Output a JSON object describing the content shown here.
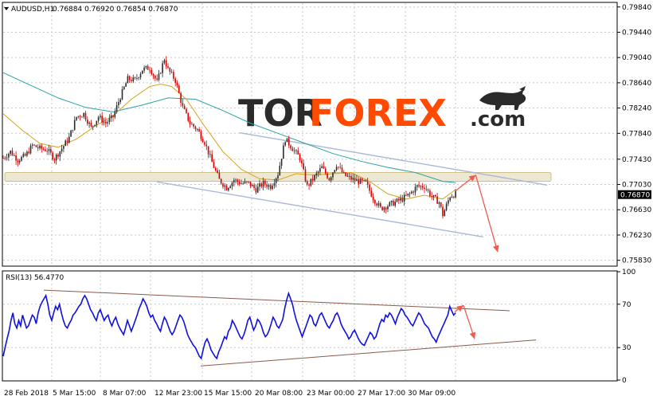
{
  "header": {
    "symbol": "AUDUSD,H1",
    "ohlc": "0.76884 0.76920 0.76854 0.76870",
    "rsi_label": "RSI(13) 56.4770"
  },
  "logo": {
    "part1": "TOR",
    "part2": "FOREX",
    "part3": ".com"
  },
  "colors": {
    "bull": "#2b2b2b",
    "bear": "#d40000",
    "ma_fast": "#d8a31a",
    "ma_slow": "#2aa3a3",
    "channel": "#aab8d8",
    "zone_fill": "#e9e4cc",
    "zone_stroke": "#cfc08a",
    "arrow": "#f05a50",
    "rsi_line": "#1010e0",
    "rsi_channel": "#8a5a4a",
    "logo_dark": "#2b2b2b",
    "logo_accent": "#ff4a00",
    "grid": "#c8c8c8"
  },
  "chart_data": [
    {
      "type": "candlestick",
      "title": "AUDUSD,H1",
      "y_ticks": [
        "0.79840",
        "0.79440",
        "0.79040",
        "0.78640",
        "0.78240",
        "0.77840",
        "0.77430",
        "0.77030",
        "0.76630",
        "0.76230",
        "0.75830"
      ],
      "ylim": [
        0.7575,
        0.799
      ],
      "current_price": "0.76870",
      "x_ticks": [
        "28 Feb 2018",
        "5 Mar 15:00",
        "8 Mar 07:00",
        "12 Mar 23:00",
        "15 Mar 15:00",
        "20 Mar 08:00",
        "23 Mar 00:00",
        "27 Mar 17:00",
        "30 Mar 09:00"
      ],
      "price_path": [
        [
          0,
          0.7745
        ],
        [
          4,
          0.7755
        ],
        [
          8,
          0.7742
        ],
        [
          12,
          0.7748
        ],
        [
          16,
          0.7765
        ],
        [
          20,
          0.776
        ],
        [
          24,
          0.7758
        ],
        [
          28,
          0.7744
        ],
        [
          32,
          0.776
        ],
        [
          36,
          0.7777
        ],
        [
          40,
          0.781
        ],
        [
          44,
          0.7815
        ],
        [
          48,
          0.7793
        ],
        [
          52,
          0.781
        ],
        [
          56,
          0.78
        ],
        [
          60,
          0.781
        ],
        [
          64,
          0.7842
        ],
        [
          68,
          0.787
        ],
        [
          72,
          0.7868
        ],
        [
          76,
          0.7885
        ],
        [
          80,
          0.7888
        ],
        [
          84,
          0.7865
        ],
        [
          88,
          0.7902
        ],
        [
          90,
          0.7885
        ],
        [
          94,
          0.7868
        ],
        [
          98,
          0.7825
        ],
        [
          102,
          0.78
        ],
        [
          106,
          0.779
        ],
        [
          110,
          0.777
        ],
        [
          114,
          0.7738
        ],
        [
          118,
          0.771
        ],
        [
          122,
          0.7698
        ],
        [
          126,
          0.771
        ],
        [
          130,
          0.7705
        ],
        [
          134,
          0.7705
        ],
        [
          138,
          0.7695
        ],
        [
          142,
          0.7705
        ],
        [
          146,
          0.77
        ],
        [
          150,
          0.772
        ],
        [
          154,
          0.7775
        ],
        [
          158,
          0.776
        ],
        [
          162,
          0.7745
        ],
        [
          166,
          0.77
        ],
        [
          170,
          0.7715
        ],
        [
          174,
          0.773
        ],
        [
          178,
          0.7712
        ],
        [
          182,
          0.7735
        ],
        [
          186,
          0.7718
        ],
        [
          190,
          0.7712
        ],
        [
          194,
          0.7708
        ],
        [
          198,
          0.7705
        ],
        [
          202,
          0.7682
        ],
        [
          206,
          0.7665
        ],
        [
          210,
          0.767
        ],
        [
          214,
          0.7675
        ],
        [
          218,
          0.768
        ],
        [
          222,
          0.7688
        ],
        [
          226,
          0.77
        ],
        [
          230,
          0.77
        ],
        [
          234,
          0.7684
        ],
        [
          238,
          0.7675
        ],
        [
          240,
          0.7655
        ],
        [
          244,
          0.7685
        ],
        [
          247,
          0.7688
        ]
      ],
      "ma_fast": [
        [
          0,
          0.7815
        ],
        [
          10,
          0.779
        ],
        [
          20,
          0.7768
        ],
        [
          30,
          0.7762
        ],
        [
          40,
          0.7775
        ],
        [
          50,
          0.7795
        ],
        [
          60,
          0.7812
        ],
        [
          70,
          0.7838
        ],
        [
          80,
          0.7858
        ],
        [
          86,
          0.7862
        ],
        [
          92,
          0.7858
        ],
        [
          100,
          0.7838
        ],
        [
          110,
          0.7795
        ],
        [
          120,
          0.7755
        ],
        [
          130,
          0.7727
        ],
        [
          140,
          0.7712
        ],
        [
          150,
          0.771
        ],
        [
          160,
          0.772
        ],
        [
          170,
          0.7718
        ],
        [
          180,
          0.772
        ],
        [
          190,
          0.7722
        ],
        [
          200,
          0.7708
        ],
        [
          210,
          0.7688
        ],
        [
          220,
          0.768
        ],
        [
          230,
          0.7686
        ],
        [
          240,
          0.768
        ],
        [
          247,
          0.7695
        ]
      ],
      "ma_slow": [
        [
          0,
          0.788
        ],
        [
          15,
          0.786
        ],
        [
          30,
          0.784
        ],
        [
          45,
          0.7825
        ],
        [
          60,
          0.7818
        ],
        [
          75,
          0.7828
        ],
        [
          90,
          0.784
        ],
        [
          105,
          0.7838
        ],
        [
          120,
          0.782
        ],
        [
          135,
          0.78
        ],
        [
          150,
          0.7784
        ],
        [
          165,
          0.7768
        ],
        [
          180,
          0.7752
        ],
        [
          195,
          0.774
        ],
        [
          210,
          0.773
        ],
        [
          225,
          0.7722
        ],
        [
          240,
          0.7708
        ],
        [
          247,
          0.7706
        ]
      ],
      "channel_upper": [
        [
          129,
          0.7785
        ],
        [
          297,
          0.7702
        ]
      ],
      "channel_lower": [
        [
          84,
          0.7707
        ],
        [
          262,
          0.762
        ]
      ],
      "resistance_zone": [
        0.7722,
        0.7708
      ],
      "projection": [
        [
          247,
          0.7693
        ],
        [
          258,
          0.7718
        ],
        [
          270,
          0.7596
        ]
      ]
    },
    {
      "type": "line",
      "title": "RSI(13) 56.4770",
      "y_ticks": [
        "100",
        "70",
        "30",
        "0"
      ],
      "ylim": [
        0,
        100
      ],
      "values": [
        22,
        30,
        38,
        45,
        55,
        62,
        52,
        48,
        55,
        50,
        60,
        54,
        48,
        50,
        55,
        60,
        58,
        52,
        62,
        68,
        72,
        75,
        78,
        70,
        60,
        55,
        62,
        68,
        65,
        70,
        62,
        55,
        50,
        48,
        52,
        55,
        60,
        62,
        65,
        68,
        70,
        75,
        78,
        75,
        70,
        65,
        62,
        58,
        55,
        62,
        65,
        60,
        55,
        58,
        60,
        54,
        50,
        55,
        58,
        52,
        48,
        45,
        42,
        48,
        55,
        50,
        45,
        50,
        55,
        60,
        66,
        70,
        75,
        72,
        68,
        62,
        58,
        60,
        55,
        52,
        48,
        45,
        52,
        58,
        55,
        50,
        45,
        42,
        45,
        50,
        55,
        60,
        58,
        54,
        48,
        42,
        38,
        35,
        32,
        30,
        26,
        22,
        20,
        28,
        35,
        38,
        34,
        28,
        25,
        22,
        20,
        26,
        30,
        35,
        40,
        38,
        45,
        48,
        55,
        52,
        48,
        44,
        40,
        38,
        42,
        48,
        55,
        58,
        52,
        46,
        50,
        56,
        54,
        50,
        44,
        40,
        42,
        46,
        52,
        58,
        55,
        50,
        48,
        52,
        56,
        66,
        74,
        80,
        75,
        70,
        62,
        55,
        50,
        45,
        40,
        45,
        50,
        55,
        60,
        58,
        52,
        50,
        55,
        60,
        62,
        58,
        54,
        50,
        48,
        52,
        55,
        60,
        62,
        58,
        52,
        48,
        45,
        42,
        38,
        40,
        44,
        46,
        42,
        38,
        35,
        33,
        32,
        36,
        40,
        44,
        42,
        38,
        40,
        46,
        52,
        56,
        54,
        60,
        58,
        62,
        60,
        56,
        52,
        58,
        62,
        66,
        64,
        60,
        58,
        55,
        52,
        50,
        54,
        58,
        62,
        60,
        56,
        52,
        50,
        48,
        44,
        40,
        38,
        35,
        40,
        44,
        48,
        52,
        56,
        60,
        68,
        64,
        60,
        62
      ]
    }
  ]
}
